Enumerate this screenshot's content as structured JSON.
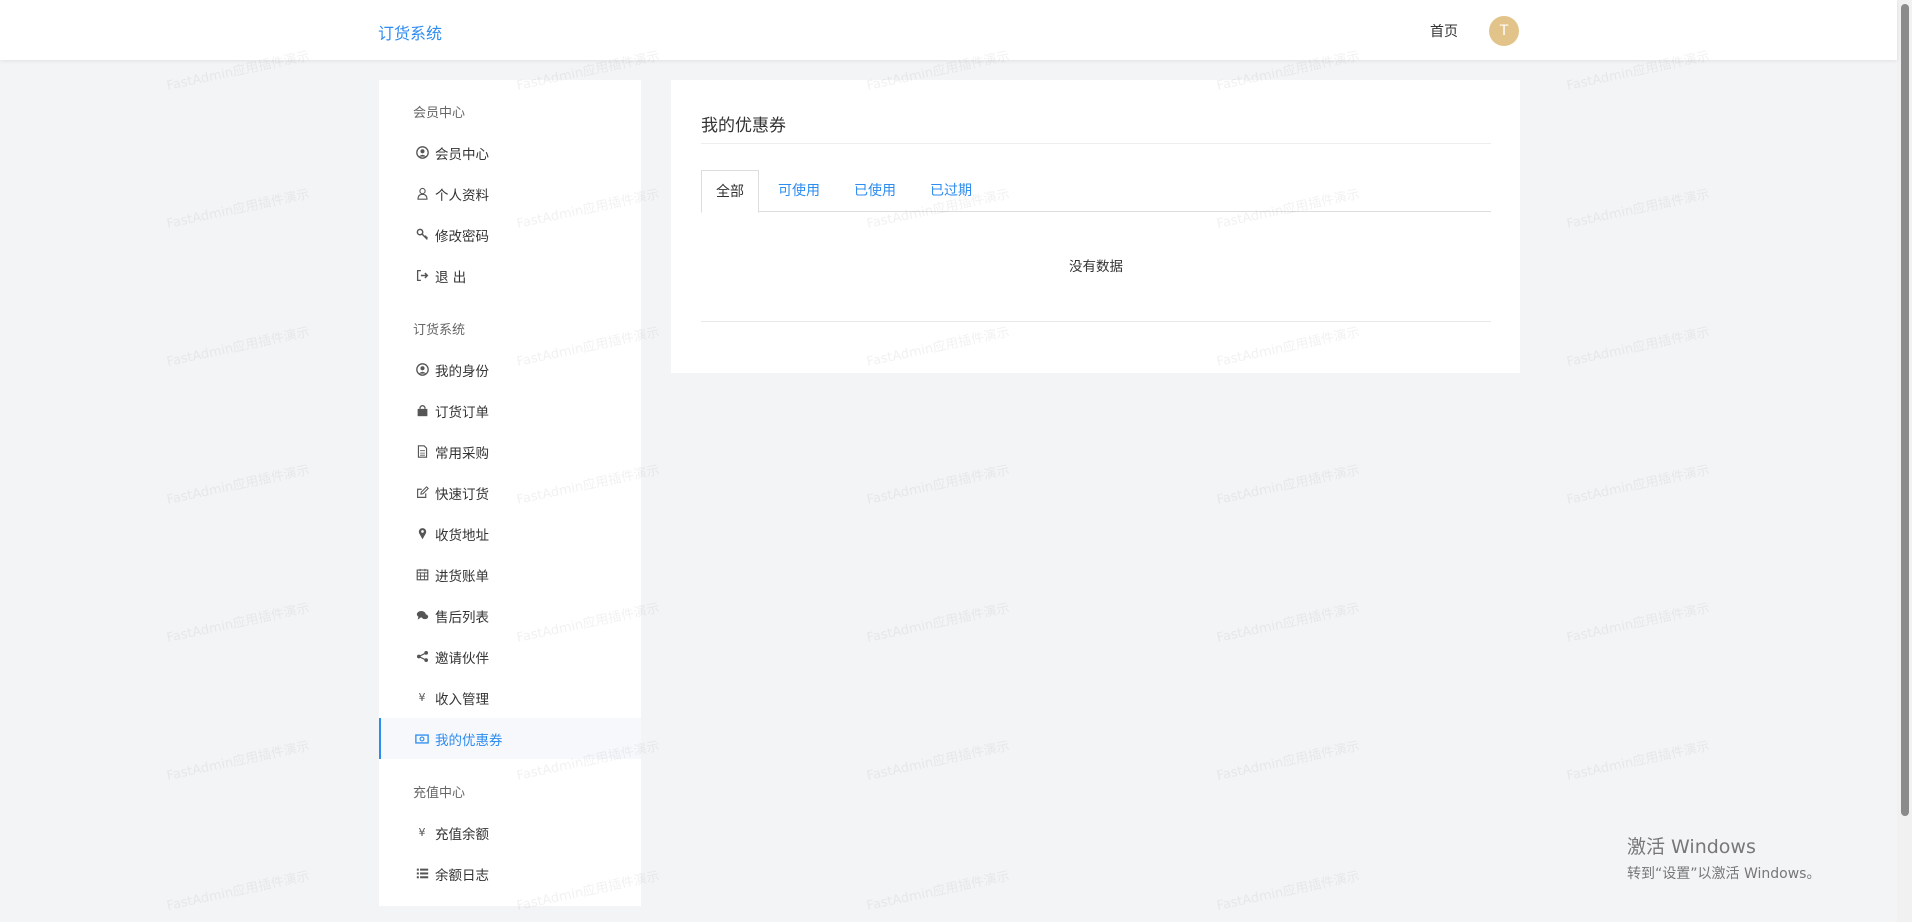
{
  "header": {
    "brand": "订货系统",
    "home_link": "首页",
    "avatar_initial": "T"
  },
  "sidebar": {
    "groups": [
      {
        "title": "会员中心",
        "items": [
          {
            "label": "会员中心",
            "icon": "user-circle-icon"
          },
          {
            "label": "个人资料",
            "icon": "user-icon"
          },
          {
            "label": "修改密码",
            "icon": "key-icon"
          },
          {
            "label": "退 出",
            "icon": "sign-out-icon"
          }
        ]
      },
      {
        "title": "订货系统",
        "items": [
          {
            "label": "我的身份",
            "icon": "user-circle-icon"
          },
          {
            "label": "订货订单",
            "icon": "shopping-bag-icon"
          },
          {
            "label": "常用采购",
            "icon": "file-icon"
          },
          {
            "label": "快速订货",
            "icon": "edit-icon"
          },
          {
            "label": "收货地址",
            "icon": "map-marker-icon"
          },
          {
            "label": "进货账单",
            "icon": "calendar-icon"
          },
          {
            "label": "售后列表",
            "icon": "comments-icon"
          },
          {
            "label": "邀请伙伴",
            "icon": "share-icon"
          },
          {
            "label": "收入管理",
            "icon": "yen-icon"
          },
          {
            "label": "我的优惠券",
            "icon": "money-icon",
            "active": true
          }
        ]
      },
      {
        "title": "充值中心",
        "items": [
          {
            "label": "充值余额",
            "icon": "yen-icon"
          },
          {
            "label": "余额日志",
            "icon": "list-icon"
          }
        ]
      }
    ]
  },
  "main": {
    "title": "我的优惠券",
    "tabs": [
      {
        "label": "全部",
        "active": true
      },
      {
        "label": "可使用"
      },
      {
        "label": "已使用"
      },
      {
        "label": "已过期"
      }
    ],
    "empty_text": "没有数据"
  },
  "watermark_text": "FastAdmin应用插件演示",
  "windows_notice": {
    "title": "激活 Windows",
    "subtitle": "转到“设置”以激活 Windows。"
  },
  "colors": {
    "accent": "#2d8cf0",
    "avatar": "#e2c389",
    "page_bg": "#f3f4f6"
  }
}
